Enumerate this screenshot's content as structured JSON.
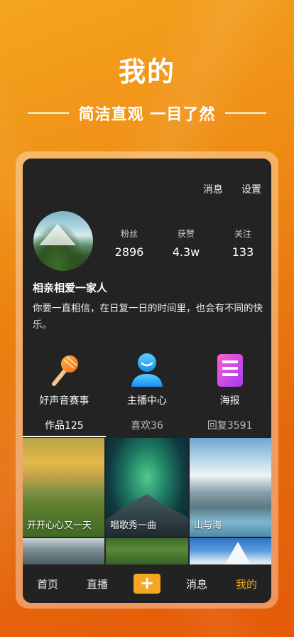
{
  "promo": {
    "title": "我的",
    "subtitle": "简洁直观 一目了然"
  },
  "header": {
    "messages_link": "消息",
    "settings_link": "设置"
  },
  "profile": {
    "stats": [
      {
        "label": "粉丝",
        "value": "2896"
      },
      {
        "label": "获赞",
        "value": "4.3w"
      },
      {
        "label": "关注",
        "value": "133"
      }
    ],
    "nickname": "相亲相爱一家人",
    "bio": "你要一直相信，在日复一日的时间里，也会有不同的快乐。"
  },
  "features": [
    {
      "label": "好声音赛事",
      "icon": "microphone-icon"
    },
    {
      "label": "主播中心",
      "icon": "anchor-user-icon"
    },
    {
      "label": "海报",
      "icon": "poster-icon"
    }
  ],
  "tabs": [
    {
      "label": "作品125",
      "active": true
    },
    {
      "label": "喜欢36",
      "active": false
    },
    {
      "label": "回复3591",
      "active": false
    }
  ],
  "works": [
    {
      "caption": "开开心心又一天"
    },
    {
      "caption": "唱歌秀一曲"
    },
    {
      "caption": "山与海"
    }
  ],
  "bottom_nav": {
    "home": "首页",
    "live": "直播",
    "plus": "+",
    "messages": "消息",
    "me": "我的"
  },
  "colors": {
    "accent": "#f5a623",
    "background_orange": "#ee8a12",
    "panel": "#232323"
  }
}
